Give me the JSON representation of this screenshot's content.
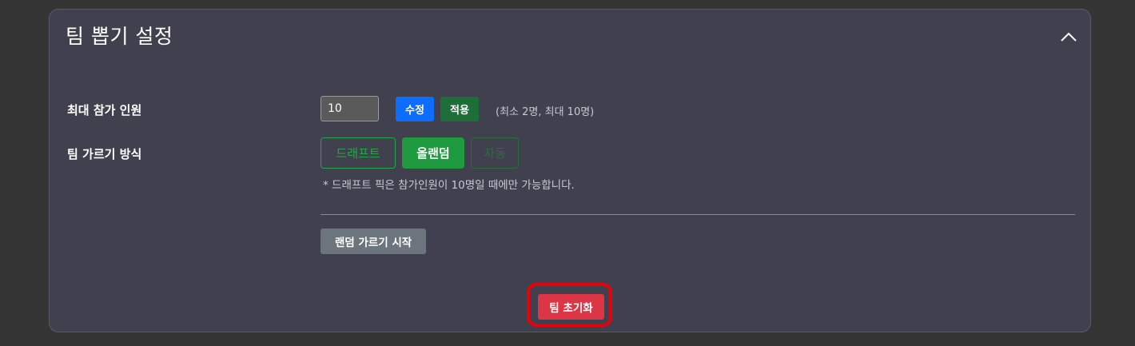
{
  "panel": {
    "title": "팀 뽑기 설정",
    "collapse_icon": "chevron-up-icon"
  },
  "max_participants": {
    "label": "최대 참가 인원",
    "value": "10",
    "edit_label": "수정",
    "apply_label": "적용",
    "range_hint": "(최소 2명, 최대 10명)"
  },
  "team_mode": {
    "label": "팀 가르기 방식",
    "options": [
      "드래프트",
      "올랜덤",
      "자동"
    ],
    "selected": "올랜덤",
    "note": "* 드래프트 픽은 참가인원이 10명일 때에만 가능합니다."
  },
  "actions": {
    "start_label": "랜덤 가르기 시작",
    "reset_label": "팀 초기화"
  },
  "colors": {
    "background": "#353535",
    "panel": "#41404f",
    "primary": "#0d6efd",
    "success": "#1f9a40",
    "secondary": "#6c757d",
    "danger": "#dc3545",
    "highlight": "#e8000a"
  }
}
